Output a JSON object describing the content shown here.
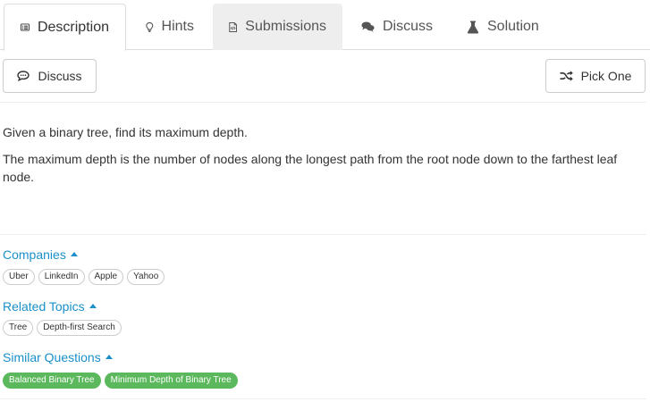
{
  "tabs": [
    {
      "label": "Description",
      "icon": "description-icon",
      "state": "active"
    },
    {
      "label": "Hints",
      "icon": "lightbulb-icon",
      "state": "normal"
    },
    {
      "label": "Submissions",
      "icon": "code-file-icon",
      "state": "hovered"
    },
    {
      "label": "Discuss",
      "icon": "comments-icon",
      "state": "normal"
    },
    {
      "label": "Solution",
      "icon": "flask-icon",
      "state": "normal"
    }
  ],
  "toolbar": {
    "discuss_label": "Discuss",
    "pick_one_label": "Pick One"
  },
  "description": {
    "paragraph1": "Given a binary tree, find its maximum depth.",
    "paragraph2": "The maximum depth is the number of nodes along the longest path from the root node down to the farthest leaf node."
  },
  "companies": {
    "title": "Companies",
    "tags": [
      "Uber",
      "LinkedIn",
      "Apple",
      "Yahoo"
    ]
  },
  "related_topics": {
    "title": "Related Topics",
    "tags": [
      "Tree",
      "Depth-first Search"
    ]
  },
  "similar_questions": {
    "title": "Similar Questions",
    "tags": [
      "Balanced Binary Tree",
      "Minimum Depth of Binary Tree"
    ]
  },
  "colors": {
    "link": "#1a8fc8",
    "tag_green": "#5cb85c",
    "border": "#dddddd"
  }
}
